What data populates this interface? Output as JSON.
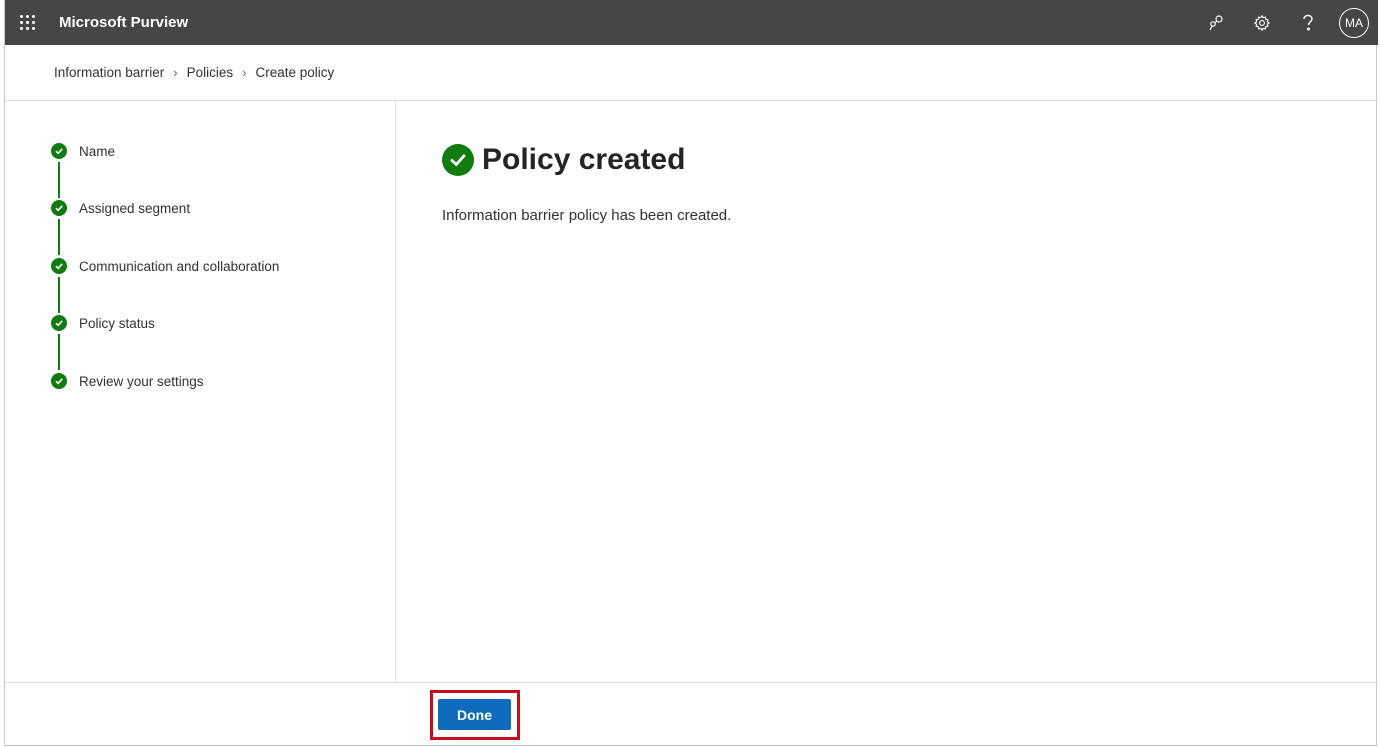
{
  "header": {
    "app_title": "Microsoft Purview",
    "avatar_initials": "MA",
    "icons": [
      "app-launcher-icon",
      "connection-icon",
      "gear-icon",
      "help-icon"
    ]
  },
  "breadcrumb": {
    "items": [
      {
        "label": "Information barrier"
      },
      {
        "label": "Policies"
      },
      {
        "label": "Create policy"
      }
    ]
  },
  "steps": [
    {
      "label": "Name",
      "status": "complete"
    },
    {
      "label": "Assigned segment",
      "status": "complete"
    },
    {
      "label": "Communication and collaboration",
      "status": "complete"
    },
    {
      "label": "Policy status",
      "status": "complete"
    },
    {
      "label": "Review your settings",
      "status": "complete"
    }
  ],
  "main": {
    "title": "Policy created",
    "message": "Information barrier policy has been created."
  },
  "footer": {
    "done_label": "Done"
  },
  "colors": {
    "topbar": "#464646",
    "success": "#107c10",
    "primary_button": "#0f6cbd",
    "highlight": "#c50f1f"
  }
}
